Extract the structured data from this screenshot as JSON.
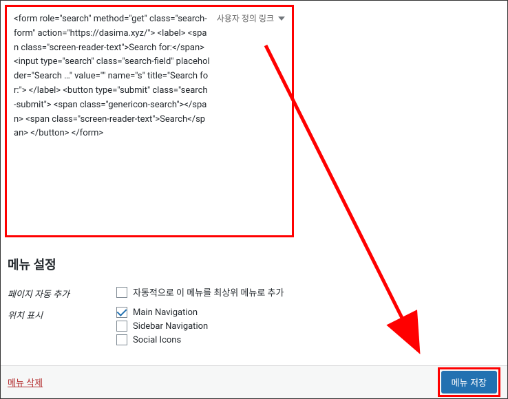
{
  "menu_item": {
    "title_html": "<form role=\"search\" method=\"get\" class=\"search-form\" action=\"https://dasima.xyz/\"> <label> <span class=\"screen-reader-text\">Search for:</span> <input type=\"search\" class=\"search-field\" placeholder=\"Search …\" value=\"\" name=\"s\" title=\"Search for:\"> </label> <button type=\"submit\" class=\"search-submit\"> <span class=\"genericon-search\"></span> <span class=\"screen-reader-text\">Search</span> </button> </form>",
    "type_label": "사용자 정의 링크"
  },
  "settings": {
    "title": "메뉴 설정",
    "rows": [
      {
        "label": "페이지 자동 추가",
        "options": [
          {
            "label": "자동적으로 이 메뉴를 최상위 메뉴로 추가",
            "checked": false
          }
        ]
      },
      {
        "label": "위치 표시",
        "options": [
          {
            "label": "Main Navigation",
            "checked": true
          },
          {
            "label": "Sidebar Navigation",
            "checked": false
          },
          {
            "label": "Social Icons",
            "checked": false
          }
        ]
      }
    ]
  },
  "footer": {
    "delete_label": "메뉴 삭제",
    "save_label": "메뉴 저장"
  }
}
